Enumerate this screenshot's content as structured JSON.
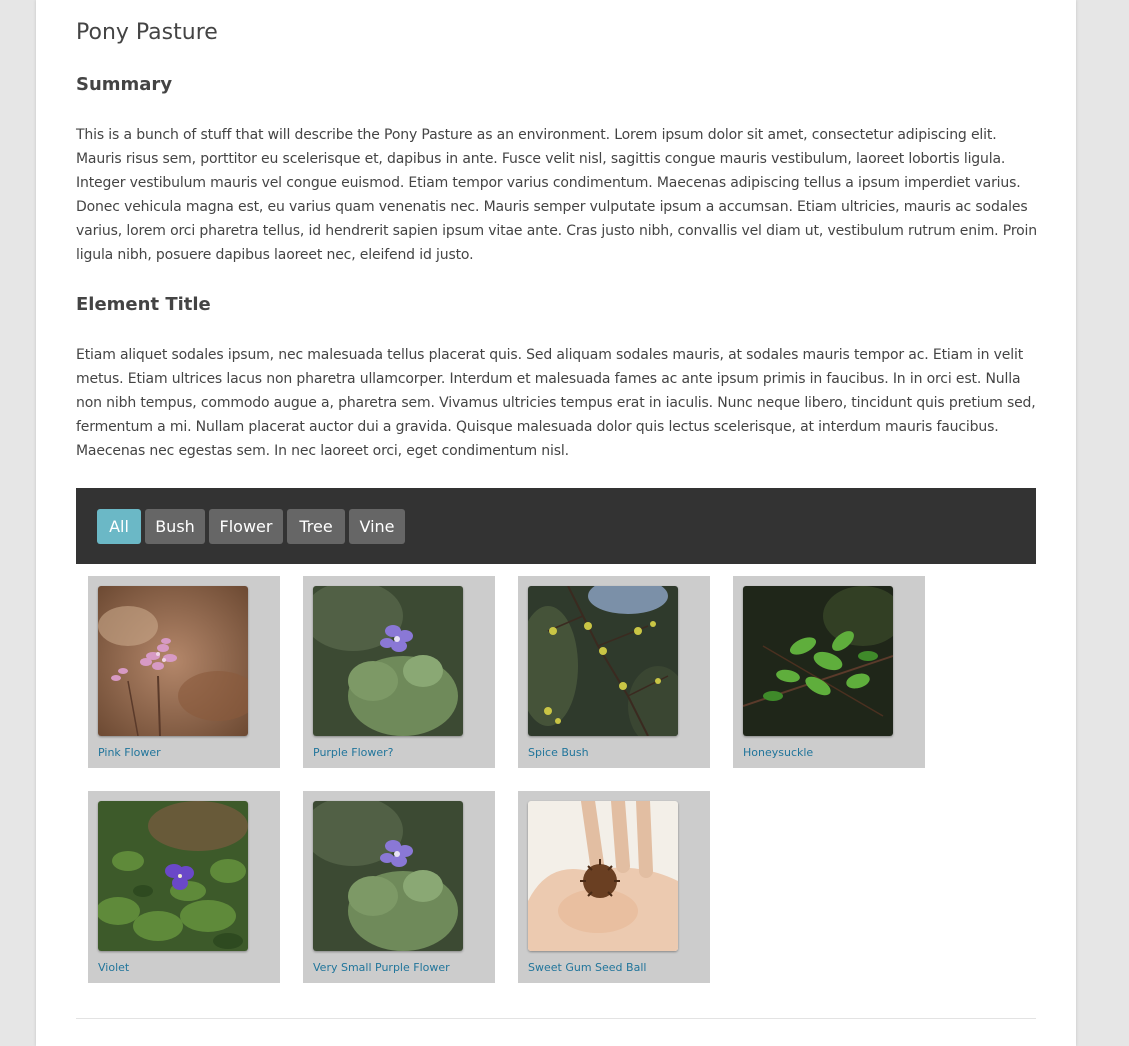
{
  "page": {
    "title": "Pony Pasture"
  },
  "summary": {
    "heading": "Summary",
    "text": "This is a bunch of stuff that will describe the Pony Pasture as an environment. Lorem ipsum dolor sit amet, consectetur adipiscing elit. Mauris risus sem, porttitor eu scelerisque et, dapibus in ante. Fusce velit nisl, sagittis congue mauris vestibulum, laoreet lobortis ligula. Integer vestibulum mauris vel congue euismod. Etiam tempor varius condimentum. Maecenas adipiscing tellus a ipsum imperdiet varius. Donec vehicula magna est, eu varius quam venenatis nec. Mauris semper vulputate ipsum a accumsan. Etiam ultricies, mauris ac sodales varius, lorem orci pharetra tellus, id hendrerit sapien ipsum vitae ante. Cras justo nibh, convallis vel diam ut, vestibulum rutrum enim. Proin ligula nibh, posuere dapibus laoreet nec, eleifend id justo."
  },
  "element": {
    "heading": "Element Title",
    "text": "Etiam aliquet sodales ipsum, nec malesuada tellus placerat quis. Sed aliquam sodales mauris, at sodales mauris tempor ac. Etiam in velit metus. Etiam ultrices lacus non pharetra ullamcorper. Interdum et malesuada fames ac ante ipsum primis in faucibus. In in orci est. Nulla non nibh tempus, commodo augue a, pharetra sem. Vivamus ultricies tempus erat in iaculis. Nunc neque libero, tincidunt quis pretium sed, fermentum a mi. Nullam placerat auctor dui a gravida. Quisque malesuada dolor quis lectus scelerisque, at interdum mauris faucibus. Maecenas nec egestas sem. In nec laoreet orci, eget condimentum nisl."
  },
  "filters": {
    "items": [
      {
        "label": "All",
        "active": true
      },
      {
        "label": "Bush",
        "active": false
      },
      {
        "label": "Flower",
        "active": false
      },
      {
        "label": "Tree",
        "active": false
      },
      {
        "label": "Vine",
        "active": false
      }
    ],
    "active_color": "#6bb8c6",
    "inactive_color": "#666666"
  },
  "gallery": {
    "items": [
      {
        "caption": "Pink Flower"
      },
      {
        "caption": "Purple Flower?"
      },
      {
        "caption": "Spice Bush"
      },
      {
        "caption": "Honeysuckle"
      },
      {
        "caption": "Violet"
      },
      {
        "caption": "Very Small Purple Flower"
      },
      {
        "caption": "Sweet Gum Seed Ball"
      }
    ]
  },
  "colors": {
    "link": "#21759b",
    "filter_bar": "#333333",
    "card_bg": "#cccccc"
  }
}
